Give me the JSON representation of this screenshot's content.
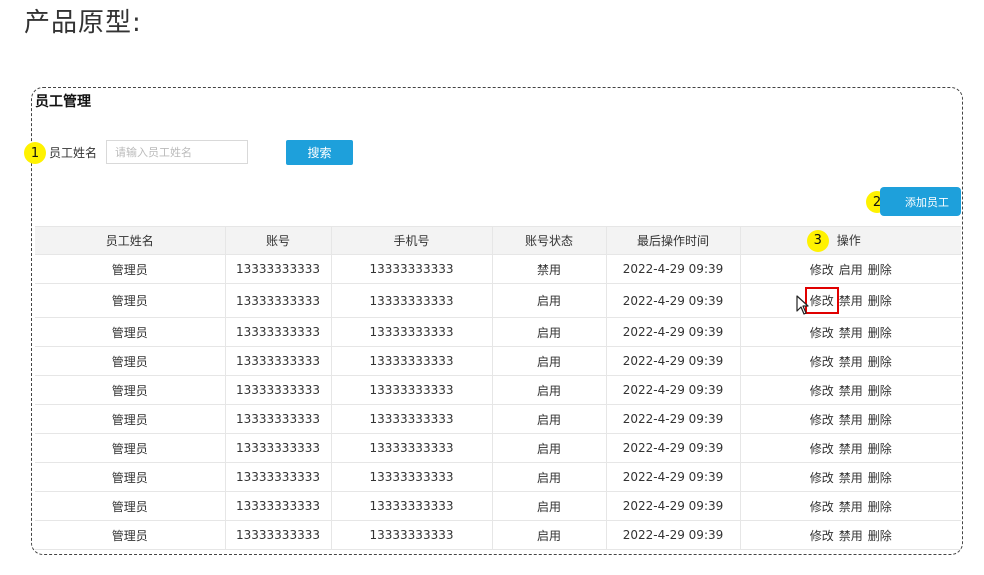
{
  "page": {
    "heading": "产品原型:"
  },
  "panel": {
    "title": "员工管理"
  },
  "markers": {
    "one": "1",
    "two": "2",
    "three": "3"
  },
  "search": {
    "label": "员工姓名",
    "placeholder": "请输入员工姓名",
    "button": "搜索"
  },
  "add_button": "添加员工",
  "table": {
    "headers": [
      "员工姓名",
      "账号",
      "手机号",
      "账号状态",
      "最后操作时间",
      "操作"
    ],
    "rows": [
      {
        "name": "管理员",
        "account": "13333333333",
        "phone": "13333333333",
        "status": "禁用",
        "time": "2022-4-29 09:39",
        "edit": "修改",
        "toggle": "启用",
        "delete": "删除"
      },
      {
        "name": "管理员",
        "account": "13333333333",
        "phone": "13333333333",
        "status": "启用",
        "time": "2022-4-29 09:39",
        "edit": "修改",
        "toggle": "禁用",
        "delete": "删除"
      },
      {
        "name": "管理员",
        "account": "13333333333",
        "phone": "13333333333",
        "status": "启用",
        "time": "2022-4-29 09:39",
        "edit": "修改",
        "toggle": "禁用",
        "delete": "删除"
      },
      {
        "name": "管理员",
        "account": "13333333333",
        "phone": "13333333333",
        "status": "启用",
        "time": "2022-4-29 09:39",
        "edit": "修改",
        "toggle": "禁用",
        "delete": "删除"
      },
      {
        "name": "管理员",
        "account": "13333333333",
        "phone": "13333333333",
        "status": "启用",
        "time": "2022-4-29 09:39",
        "edit": "修改",
        "toggle": "禁用",
        "delete": "删除"
      },
      {
        "name": "管理员",
        "account": "13333333333",
        "phone": "13333333333",
        "status": "启用",
        "time": "2022-4-29 09:39",
        "edit": "修改",
        "toggle": "禁用",
        "delete": "删除"
      },
      {
        "name": "管理员",
        "account": "13333333333",
        "phone": "13333333333",
        "status": "启用",
        "time": "2022-4-29 09:39",
        "edit": "修改",
        "toggle": "禁用",
        "delete": "删除"
      },
      {
        "name": "管理员",
        "account": "13333333333",
        "phone": "13333333333",
        "status": "启用",
        "time": "2022-4-29 09:39",
        "edit": "修改",
        "toggle": "禁用",
        "delete": "删除"
      },
      {
        "name": "管理员",
        "account": "13333333333",
        "phone": "13333333333",
        "status": "启用",
        "time": "2022-4-29 09:39",
        "edit": "修改",
        "toggle": "禁用",
        "delete": "删除"
      },
      {
        "name": "管理员",
        "account": "13333333333",
        "phone": "13333333333",
        "status": "启用",
        "time": "2022-4-29 09:39",
        "edit": "修改",
        "toggle": "禁用",
        "delete": "删除"
      }
    ]
  },
  "colors": {
    "accent": "#1ea0db",
    "marker": "#fff200",
    "highlight_box": "#e00000",
    "header_bg": "#f3f3f3"
  },
  "icons": {
    "cursor": "mouse-pointer-icon"
  }
}
